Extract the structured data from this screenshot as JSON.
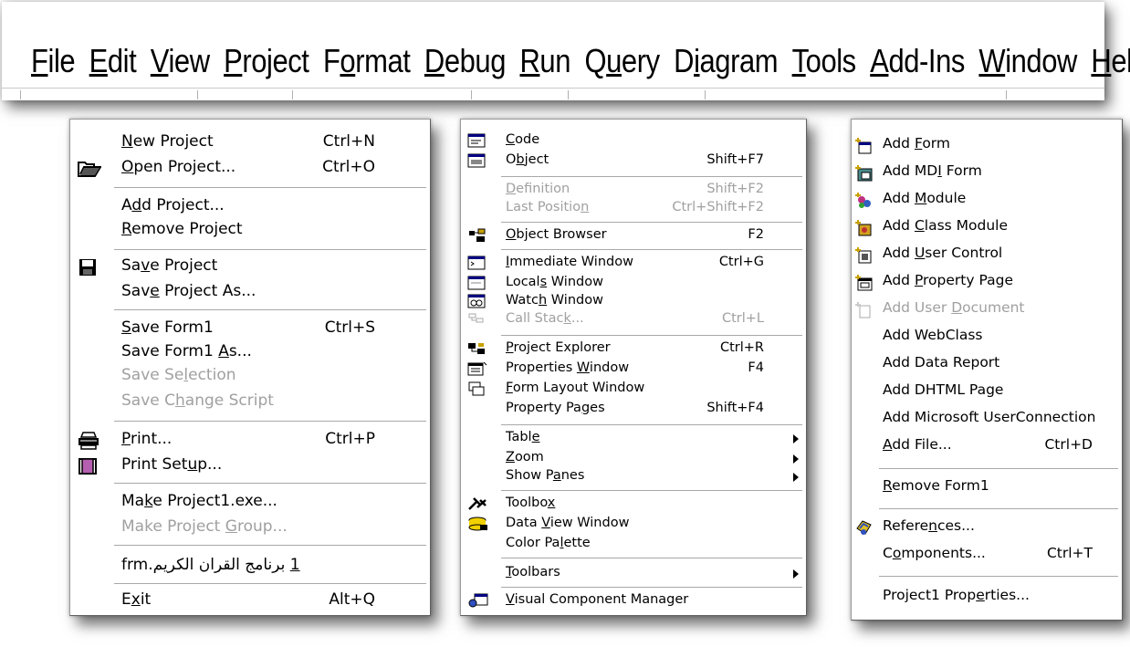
{
  "menubar": {
    "items": [
      {
        "pre": "",
        "u": "F",
        "post": "ile"
      },
      {
        "pre": "",
        "u": "E",
        "post": "dit"
      },
      {
        "pre": "",
        "u": "V",
        "post": "iew"
      },
      {
        "pre": "",
        "u": "P",
        "post": "roject"
      },
      {
        "pre": "F",
        "u": "o",
        "post": "rmat"
      },
      {
        "pre": "",
        "u": "D",
        "post": "ebug"
      },
      {
        "pre": "",
        "u": "R",
        "post": "un"
      },
      {
        "pre": "Q",
        "u": "u",
        "post": "ery"
      },
      {
        "pre": "D",
        "u": "i",
        "post": "agram"
      },
      {
        "pre": "",
        "u": "T",
        "post": "ools"
      },
      {
        "pre": "",
        "u": "A",
        "post": "dd-Ins"
      },
      {
        "pre": "",
        "u": "W",
        "post": "indow"
      },
      {
        "pre": "",
        "u": "H",
        "post": "elp"
      }
    ]
  },
  "file_menu": {
    "items": [
      {
        "pre": "",
        "u": "N",
        "post": "ew Project",
        "shortcut": "Ctrl+N"
      },
      {
        "pre": "",
        "u": "O",
        "post": "pen Project...",
        "shortcut": "Ctrl+O",
        "icon": "open-folder-icon"
      },
      {
        "pre": "A",
        "u": "d",
        "post": "d Project...",
        "shortcut": ""
      },
      {
        "pre": "",
        "u": "R",
        "post": "emove Project",
        "shortcut": ""
      },
      {
        "pre": "Sa",
        "u": "v",
        "post": "e Project",
        "shortcut": "",
        "icon": "floppy-disk-icon"
      },
      {
        "pre": "Sav",
        "u": "e",
        "post": " Project As...",
        "shortcut": ""
      },
      {
        "pre": "",
        "u": "S",
        "post": "ave Form1",
        "shortcut": "Ctrl+S"
      },
      {
        "pre": "Save Form1 ",
        "u": "A",
        "post": "s...",
        "shortcut": ""
      },
      {
        "pre": "Save Se",
        "u": "l",
        "post": "ection",
        "shortcut": "",
        "disabled": true
      },
      {
        "pre": "Save C",
        "u": "h",
        "post": "ange Script",
        "shortcut": "",
        "disabled": true
      },
      {
        "pre": "",
        "u": "P",
        "post": "rint...",
        "shortcut": "Ctrl+P",
        "icon": "printer-icon"
      },
      {
        "pre": "Print Set",
        "u": "u",
        "post": "p...",
        "shortcut": "",
        "icon": "print-setup-icon"
      },
      {
        "pre": "Ma",
        "u": "k",
        "post": "e Project1.exe...",
        "shortcut": ""
      },
      {
        "pre": "Make Project ",
        "u": "G",
        "post": "roup...",
        "shortcut": "",
        "disabled": true
      },
      {
        "pre": "",
        "u": "1",
        "post": " برنامج القران الكريم.frm",
        "shortcut": ""
      },
      {
        "pre": "E",
        "u": "x",
        "post": "it",
        "shortcut": "Alt+Q"
      }
    ]
  },
  "view_menu": {
    "items": [
      {
        "pre": "",
        "u": "C",
        "post": "ode",
        "shortcut": "",
        "icon": "code-window-icon"
      },
      {
        "pre": "O",
        "u": "b",
        "post": "ject",
        "shortcut": "Shift+F7",
        "icon": "object-window-icon"
      },
      {
        "pre": "",
        "u": "D",
        "post": "efinition",
        "shortcut": "Shift+F2",
        "disabled": true
      },
      {
        "pre": "Last Positio",
        "u": "n",
        "post": "",
        "shortcut": "Ctrl+Shift+F2",
        "disabled": true
      },
      {
        "pre": "",
        "u": "O",
        "post": "bject Browser",
        "shortcut": "F2",
        "icon": "object-browser-icon"
      },
      {
        "pre": "",
        "u": "I",
        "post": "mmediate Window",
        "shortcut": "Ctrl+G",
        "icon": "immediate-window-icon"
      },
      {
        "pre": "Local",
        "u": "s",
        "post": " Window",
        "shortcut": "",
        "icon": "locals-window-icon"
      },
      {
        "pre": "Watc",
        "u": "h",
        "post": " Window",
        "shortcut": "",
        "icon": "watch-window-icon"
      },
      {
        "pre": "Call Stac",
        "u": "k",
        "post": "...",
        "shortcut": "Ctrl+L",
        "disabled": true,
        "icon": "call-stack-icon"
      },
      {
        "pre": "",
        "u": "P",
        "post": "roject Explorer",
        "shortcut": "Ctrl+R",
        "icon": "project-explorer-icon"
      },
      {
        "pre": "Properties ",
        "u": "W",
        "post": "indow",
        "shortcut": "F4",
        "icon": "properties-window-icon"
      },
      {
        "pre": "",
        "u": "F",
        "post": "orm Layout Window",
        "shortcut": "",
        "icon": "form-layout-icon"
      },
      {
        "pre": "Property Pa",
        "u": "g",
        "post": "es",
        "shortcut": "Shift+F4"
      },
      {
        "pre": "Tabl",
        "u": "e",
        "post": "",
        "shortcut": "",
        "submenu": true
      },
      {
        "pre": "",
        "u": "Z",
        "post": "oom",
        "shortcut": "",
        "submenu": true
      },
      {
        "pre": "Show P",
        "u": "a",
        "post": "nes",
        "shortcut": "",
        "submenu": true
      },
      {
        "pre": "Toolbo",
        "u": "x",
        "post": "",
        "shortcut": "",
        "icon": "toolbox-icon"
      },
      {
        "pre": "Data ",
        "u": "V",
        "post": "iew Window",
        "shortcut": "",
        "icon": "data-view-icon"
      },
      {
        "pre": "Color Pa",
        "u": "l",
        "post": "ette",
        "shortcut": ""
      },
      {
        "pre": "",
        "u": "T",
        "post": "oolbars",
        "shortcut": "",
        "submenu": true
      },
      {
        "pre": "",
        "u": "V",
        "post": "isual Component Manager",
        "shortcut": "",
        "icon": "component-manager-icon"
      }
    ]
  },
  "project_menu": {
    "items": [
      {
        "pre": "Add ",
        "u": "F",
        "post": "orm",
        "shortcut": "",
        "icon": "add-form-icon"
      },
      {
        "pre": "Add MD",
        "u": "I",
        "post": " Form",
        "shortcut": "",
        "icon": "add-mdi-form-icon"
      },
      {
        "pre": "Add ",
        "u": "M",
        "post": "odule",
        "shortcut": "",
        "icon": "add-module-icon"
      },
      {
        "pre": "Add ",
        "u": "C",
        "post": "lass Module",
        "shortcut": "",
        "icon": "add-class-module-icon"
      },
      {
        "pre": "Add ",
        "u": "U",
        "post": "ser Control",
        "shortcut": "",
        "icon": "add-user-control-icon"
      },
      {
        "pre": "Add ",
        "u": "P",
        "post": "roperty Page",
        "shortcut": "",
        "icon": "add-property-page-icon"
      },
      {
        "pre": "Add User ",
        "u": "D",
        "post": "ocument",
        "shortcut": "",
        "disabled": true,
        "icon": "add-user-document-icon"
      },
      {
        "pre": "Add WebClass",
        "u": "",
        "post": "",
        "shortcut": ""
      },
      {
        "pre": "Add Data Report",
        "u": "",
        "post": "",
        "shortcut": ""
      },
      {
        "pre": "Add DHTML Page",
        "u": "",
        "post": "",
        "shortcut": ""
      },
      {
        "pre": "Add Microsoft UserConnection",
        "u": "",
        "post": "",
        "shortcut": ""
      },
      {
        "pre": "",
        "u": "A",
        "post": "dd File...",
        "shortcut": "Ctrl+D"
      },
      {
        "pre": "",
        "u": "R",
        "post": "emove Form1",
        "shortcut": ""
      },
      {
        "pre": "Refere",
        "u": "n",
        "post": "ces...",
        "shortcut": "",
        "icon": "references-icon"
      },
      {
        "pre": "C",
        "u": "o",
        "post": "mponents...",
        "shortcut": "Ctrl+T"
      },
      {
        "pre": "Project1 Prop",
        "u": "e",
        "post": "rties...",
        "shortcut": ""
      }
    ]
  },
  "colors": {
    "disabled_text": "#a0a0a0",
    "separator": "#a8a8a8"
  }
}
